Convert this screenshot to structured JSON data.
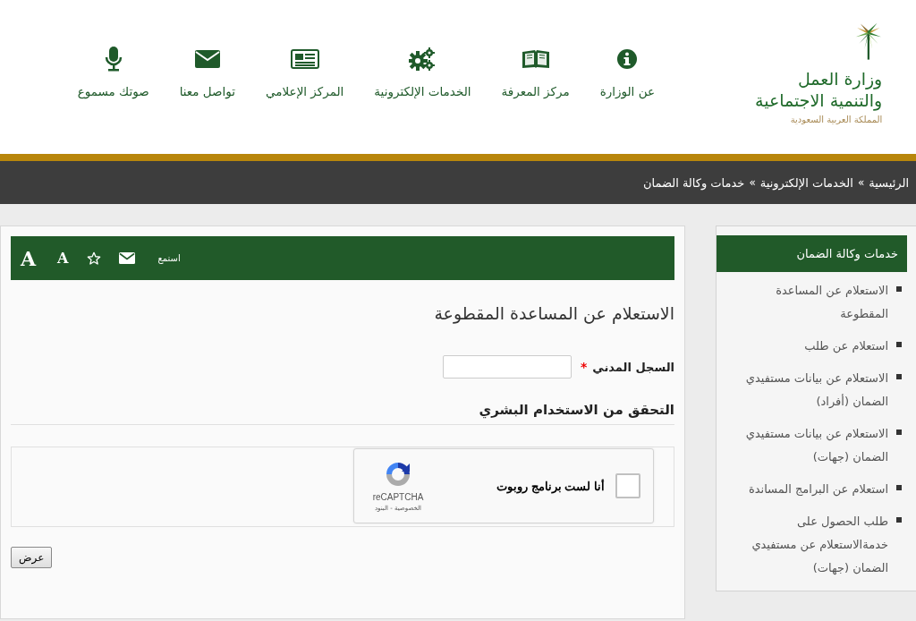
{
  "logo": {
    "title_line_1": "وزارة العمل",
    "title_line_2": "والتنمية الاجتماعية",
    "subtitle": "المملكة العربية السعودية"
  },
  "nav": [
    {
      "kind": "info",
      "label": "عن الوزارة"
    },
    {
      "kind": "book",
      "label": "مركز المعرفة"
    },
    {
      "kind": "gears",
      "label": "الخدمات الإلكترونية"
    },
    {
      "kind": "newspaper",
      "label": "المركز الإعلامي"
    },
    {
      "kind": "mail",
      "label": "تواصل معنا"
    },
    {
      "kind": "mic",
      "label": "صوتك مسموع"
    }
  ],
  "breadcrumb": {
    "separator": "»",
    "items": [
      "الرئيسية",
      "الخدمات الإلكترونية",
      "خدمات وكالة الضمان"
    ]
  },
  "sidebar": {
    "title": "خدمات وكالة الضمان",
    "items": [
      "الاستعلام عن المساعدة المقطوعة",
      "استعلام عن طلب",
      "الاستعلام عن بيانات مستفيدي الضمان (أفراد)",
      "الاستعلام عن بيانات مستفيدي الضمان (جهات)",
      "استعلام عن البرامج المساندة",
      "طلب الحصول على خدمةالاستعلام عن مستفيدي الضمان (جهات)"
    ]
  },
  "toolbar": [
    {
      "kind": "listen",
      "label": "استمع"
    },
    {
      "kind": "mail"
    },
    {
      "kind": "star"
    },
    {
      "kind": "font_small",
      "label": "A"
    },
    {
      "kind": "font_large",
      "label": "A"
    }
  ],
  "form": {
    "title": "الاستعلام عن المساعدة المقطوعة",
    "field": {
      "label": "السجل المدني",
      "required_mark": "*"
    },
    "verification_heading": "التحقق من الاستخدام البشري",
    "captcha": {
      "checked": false,
      "label": "أنا لست برنامج روبوت",
      "brand": "reCAPTCHA",
      "links": "الخصوصية - البنود"
    },
    "submit": "عرض"
  }
}
